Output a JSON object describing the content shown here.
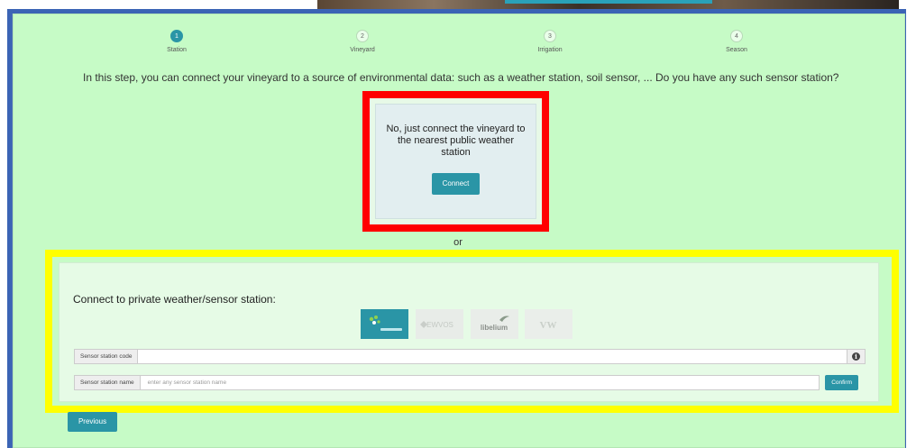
{
  "wizard": {
    "steps": [
      {
        "number": "1",
        "label": "Station",
        "active": true
      },
      {
        "number": "2",
        "label": "Vineyard",
        "active": false
      },
      {
        "number": "3",
        "label": "Irrigation",
        "active": false
      },
      {
        "number": "4",
        "label": "Season",
        "active": false
      }
    ]
  },
  "intro_text": "In this step, you can connect your vineyard to a source of environmental data: such as a weather station, soil sensor, ... Do you have any such sensor station?",
  "public_option": {
    "message": "No, just connect the vineyard to the nearest public weather station",
    "connect_label": "Connect"
  },
  "or_label": "or",
  "private_option": {
    "title": "Connect to private weather/sensor station:",
    "logos": [
      "vendor-logo-1",
      "EWVOS",
      "libelium",
      "VW"
    ],
    "station_code": {
      "label": "Sensor station code",
      "value": "",
      "placeholder": ""
    },
    "station_name": {
      "label": "Sensor station name",
      "value": "",
      "placeholder": "enter any sensor station name"
    },
    "confirm_label": "Confirm"
  },
  "footer": {
    "previous_label": "Previous"
  },
  "colors": {
    "accent": "#2a95a6",
    "background": "#c6fbc6",
    "frame": "#3b64b5",
    "highlight_red": "#ff0000",
    "highlight_yellow": "#ffff00"
  }
}
